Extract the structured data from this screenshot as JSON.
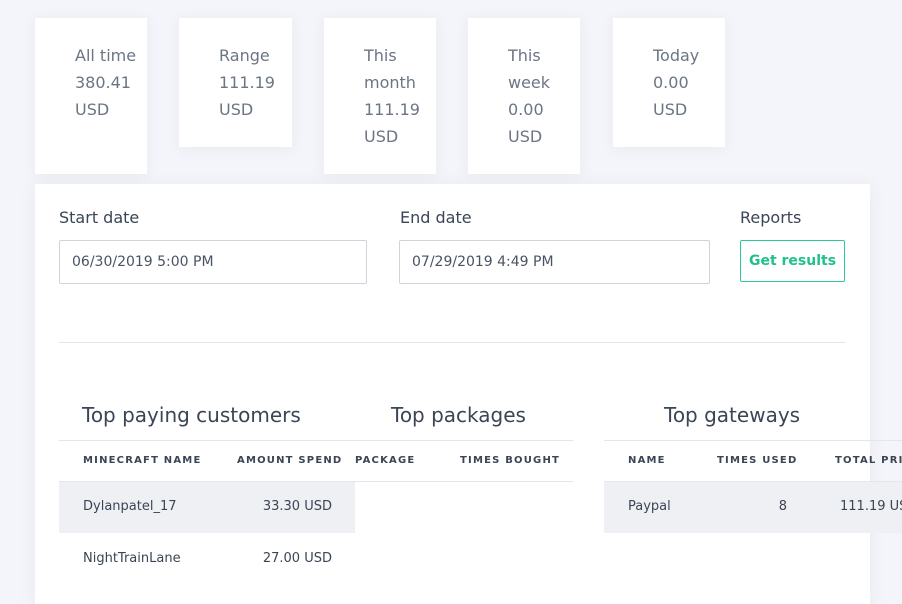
{
  "stats": [
    {
      "label": "All time 380.41 USD"
    },
    {
      "label": "Range 111.19 USD"
    },
    {
      "label": "This month 111.19 USD"
    },
    {
      "label": "This week 0.00 USD"
    },
    {
      "label": "Today 0.00 USD"
    }
  ],
  "filters": {
    "start_label": "Start date",
    "start_value": "06/30/2019 5:00 PM",
    "end_label": "End date",
    "end_value": "07/29/2019 4:49 PM",
    "reports_label": "Reports",
    "button_label": "Get results"
  },
  "customers": {
    "title": "Top paying customers",
    "headers": [
      "MINECRAFT NAME",
      "AMOUNT SPEND"
    ],
    "rows": [
      [
        "Dylanpatel_17",
        "33.30 USD"
      ],
      [
        "NightTrainLane",
        "27.00 USD"
      ]
    ]
  },
  "packages": {
    "title": "Top packages",
    "headers": [
      "PACKAGE",
      "TIMES BOUGHT"
    ]
  },
  "gateways": {
    "title": "Top gateways",
    "headers": [
      "NAME",
      "TIMES USED",
      "TOTAL PRIC"
    ],
    "rows": [
      [
        "Paypal",
        "8",
        "111.19 US"
      ]
    ]
  },
  "colors": {
    "accent": "#22c08d",
    "background": "#f4f5fa"
  }
}
